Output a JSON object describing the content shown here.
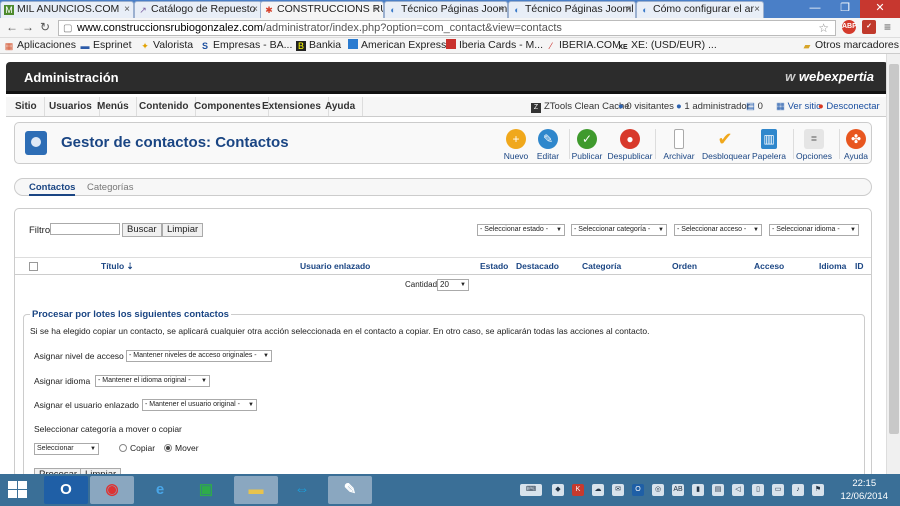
{
  "browser": {
    "tabs": [
      {
        "label": "MIL ANUNCIOS.COM",
        "icon": "mil-anuncios-favicon",
        "color": "#4d8a2e"
      },
      {
        "label": "Catálogo de Repuesto",
        "icon": "catalog-favicon",
        "color": "#7a5fa0"
      },
      {
        "label": "CONSTRUCCIONS RU",
        "icon": "joomla-favicon",
        "color": "#d6402a"
      },
      {
        "label": "Técnico Páginas Jooml",
        "icon": "joomla-forum-favicon",
        "color": "#3a7ac8"
      },
      {
        "label": "Técnico Páginas Jooml",
        "icon": "joomla-forum-favicon",
        "color": "#3a7ac8"
      },
      {
        "label": "Cómo configurar el ar",
        "icon": "joomla-forum-favicon",
        "color": "#3a7ac8"
      }
    ],
    "url_host": "www.construccionsrubiogonzalez.com",
    "url_path": "/administrator/index.php?option=com_contact&view=contacts",
    "bookmarks": [
      {
        "label": "Aplicaciones",
        "icon": "apps-grid-icon"
      },
      {
        "label": "Esprinet",
        "icon": "esprinet-favicon"
      },
      {
        "label": "Valorista",
        "icon": "valorista-favicon"
      },
      {
        "label": "Empresas - BA...",
        "icon": "bank-favicon"
      },
      {
        "label": "Bankia",
        "icon": "bankia-favicon"
      },
      {
        "label": "American Express",
        "icon": "amex-favicon"
      },
      {
        "label": "Iberia Cards - M...",
        "icon": "iberia-cards-favicon"
      },
      {
        "label": "IBERIA.COM",
        "icon": "iberia-favicon"
      },
      {
        "label": "XE: (USD/EUR) ...",
        "icon": "xe-favicon"
      }
    ],
    "other_bookmarks": "Otros marcadores",
    "abp_label": "ABP"
  },
  "admin": {
    "title": "Administración",
    "logo": "webexpertia",
    "menu": [
      "Sitio",
      "Usuarios",
      "Menús",
      "Contenido",
      "Componentes",
      "Extensiones",
      "Ayuda"
    ],
    "status": {
      "zt_cache": "ZTools Clean Cache",
      "visitors": "0 visitantes",
      "admins": "1 administrador",
      "messages": "0",
      "view_site": "Ver sitio",
      "logout": "Desconectar"
    }
  },
  "page": {
    "title": "Gestor de contactos: Contactos",
    "toolbar": [
      {
        "label": "Nuevo",
        "icon": "new-icon",
        "color": "#f0a81c"
      },
      {
        "label": "Editar",
        "icon": "edit-icon",
        "color": "#2f87cc"
      },
      {
        "label": "Publicar",
        "icon": "publish-icon",
        "color": "#3f9a2d"
      },
      {
        "label": "Despublicar",
        "icon": "unpublish-icon",
        "color": "#d8392b"
      },
      {
        "label": "Archivar",
        "icon": "archive-icon",
        "color": "#777777"
      },
      {
        "label": "Desbloquear",
        "icon": "checkin-icon",
        "color": "#f0a81c"
      },
      {
        "label": "Papelera",
        "icon": "trash-icon",
        "color": "#2f87cc"
      },
      {
        "label": "Opciones",
        "icon": "options-icon",
        "color": "#888888"
      },
      {
        "label": "Ayuda",
        "icon": "help-icon",
        "color": "#e8561f"
      }
    ],
    "subtabs": [
      "Contactos",
      "Categorías"
    ]
  },
  "filters": {
    "label": "Filtro:",
    "search_button": "Buscar",
    "clear_button": "Limpiar",
    "state": "- Seleccionar estado -",
    "category": "- Seleccionar categoría -",
    "access": "- Seleccionar acceso -",
    "language": "- Seleccionar idioma -"
  },
  "table": {
    "columns": [
      "Título",
      "Usuario enlazado",
      "Estado",
      "Destacado",
      "Categoría",
      "Orden",
      "Acceso",
      "Idioma",
      "ID"
    ],
    "quantity_label": "Cantidad",
    "quantity_value": "20"
  },
  "batch": {
    "legend": "Procesar por lotes los siguientes contactos",
    "description": "Si se ha elegido copiar un contacto, se aplicará cualquier otra acción seleccionada en el contacto a copiar. En otro caso, se aplicarán todas las acciones al contacto.",
    "access_label": "Asignar nivel de acceso",
    "access_value": "- Mantener niveles de acceso originales -",
    "language_label": "Asignar idioma",
    "language_value": "- Mantener el idioma original -",
    "user_label": "Asignar el usuario enlazado",
    "user_value": "- Mantener el usuario original -",
    "category_label": "Seleccionar categoría a mover o copiar",
    "category_value": "Seleccionar",
    "copy_label": "Copiar",
    "move_label": "Mover",
    "process_button": "Procesar",
    "clear_button": "Limpiar"
  },
  "taskbar": {
    "time": "22:15",
    "date": "12/06/2014"
  }
}
